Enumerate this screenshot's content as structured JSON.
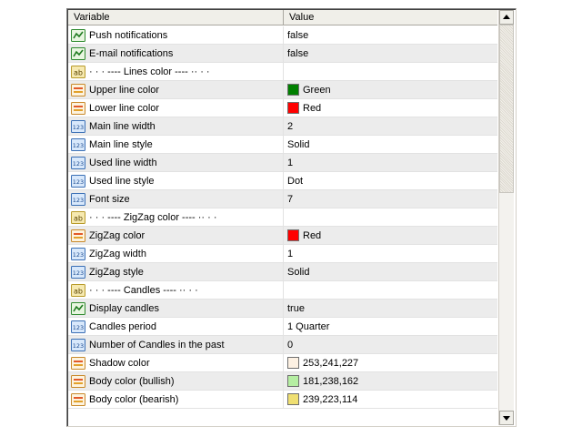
{
  "header": {
    "variable": "Variable",
    "value": "Value"
  },
  "rows": [
    {
      "type": "bool",
      "name": "Push notifications",
      "value": "false"
    },
    {
      "type": "bool",
      "name": "E-mail notifications",
      "value": "false"
    },
    {
      "type": "string",
      "name": "·    ·    · ---- Lines color ---- ··   ·    ·",
      "value": ""
    },
    {
      "type": "color",
      "name": "Upper line color",
      "value": "Green",
      "color": "#008000"
    },
    {
      "type": "color",
      "name": "Lower line color",
      "value": "Red",
      "color": "#ff0000"
    },
    {
      "type": "int",
      "name": "Main line width",
      "value": "2"
    },
    {
      "type": "int",
      "name": "Main line style",
      "value": "Solid"
    },
    {
      "type": "int",
      "name": "Used line width",
      "value": "1"
    },
    {
      "type": "int",
      "name": "Used line style",
      "value": "Dot"
    },
    {
      "type": "int",
      "name": "Font size",
      "value": "7"
    },
    {
      "type": "string",
      "name": "·    ·    · ---- ZigZag color ---- ··   ·    ·",
      "value": ""
    },
    {
      "type": "color",
      "name": "ZigZag color",
      "value": "Red",
      "color": "#ff0000"
    },
    {
      "type": "int",
      "name": "ZigZag width",
      "value": "1"
    },
    {
      "type": "int",
      "name": "ZigZag style",
      "value": "Solid"
    },
    {
      "type": "string",
      "name": "·    ·    · ---- Candles ---- ··   ·    ·",
      "value": ""
    },
    {
      "type": "bool",
      "name": "Display candles",
      "value": "true"
    },
    {
      "type": "int",
      "name": "Candles period",
      "value": "1 Quarter"
    },
    {
      "type": "int",
      "name": "Number of Candles in the past",
      "value": "0"
    },
    {
      "type": "color",
      "name": "Shadow color",
      "value": "253,241,227",
      "color": "#fdf1e3"
    },
    {
      "type": "color",
      "name": "Body color (bullish)",
      "value": "181,238,162",
      "color": "#b5eea2"
    },
    {
      "type": "color",
      "name": "Body color (bearish)",
      "value": "239,223,114",
      "color": "#efdf72"
    }
  ],
  "icons": {
    "bool": "bool-type-icon",
    "string": "string-type-icon",
    "int": "int-type-icon",
    "color": "color-type-icon"
  }
}
